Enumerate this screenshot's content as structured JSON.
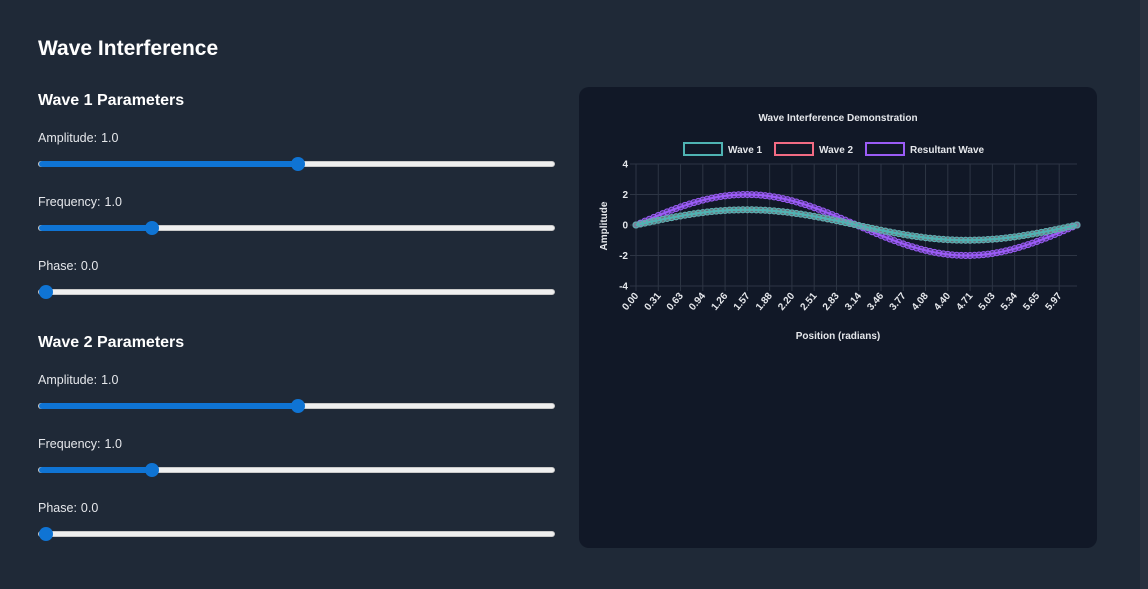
{
  "page": {
    "title": "Wave Interference"
  },
  "wave1": {
    "heading": "Wave 1 Parameters",
    "amplitude": {
      "label": "Amplitude:",
      "value": "1.0",
      "fraction": 0.5
    },
    "frequency": {
      "label": "Frequency:",
      "value": "1.0",
      "fraction": 0.21
    },
    "phase": {
      "label": "Phase:",
      "value": "0.0",
      "fraction": 0.0
    }
  },
  "wave2": {
    "heading": "Wave 2 Parameters",
    "amplitude": {
      "label": "Amplitude:",
      "value": "1.0",
      "fraction": 0.5
    },
    "frequency": {
      "label": "Frequency:",
      "value": "1.0",
      "fraction": 0.21
    },
    "phase": {
      "label": "Phase:",
      "value": "0.0",
      "fraction": 0.0
    }
  },
  "colors": {
    "accent": "#0f74d4",
    "wave1": "#4fb3b3",
    "wave2": "#f26b83",
    "resultant": "#9b5cf6"
  },
  "chart_data": {
    "type": "line",
    "title": "Wave Interference Demonstration",
    "xlabel": "Position (radians)",
    "ylabel": "Amplitude",
    "ylim": [
      -4,
      4
    ],
    "yticks": [
      "4",
      "2",
      "0",
      "-2",
      "-4"
    ],
    "xtick_labels": [
      "0.00",
      "0.31",
      "0.63",
      "0.94",
      "1.26",
      "1.57",
      "1.88",
      "2.20",
      "2.51",
      "2.83",
      "3.14",
      "3.46",
      "3.77",
      "4.08",
      "4.40",
      "4.71",
      "5.03",
      "5.34",
      "5.65",
      "5.97"
    ],
    "x_range": [
      0,
      6.2832
    ],
    "num_points": 100,
    "legend_position": "top",
    "grid": true,
    "series": [
      {
        "name": "Wave 1",
        "amplitude": 1.0,
        "frequency": 1.0,
        "phase": 0.0
      },
      {
        "name": "Wave 2",
        "amplitude": 1.0,
        "frequency": 1.0,
        "phase": 0.0
      },
      {
        "name": "Resultant Wave",
        "formula": "Wave 1 + Wave 2"
      }
    ]
  }
}
